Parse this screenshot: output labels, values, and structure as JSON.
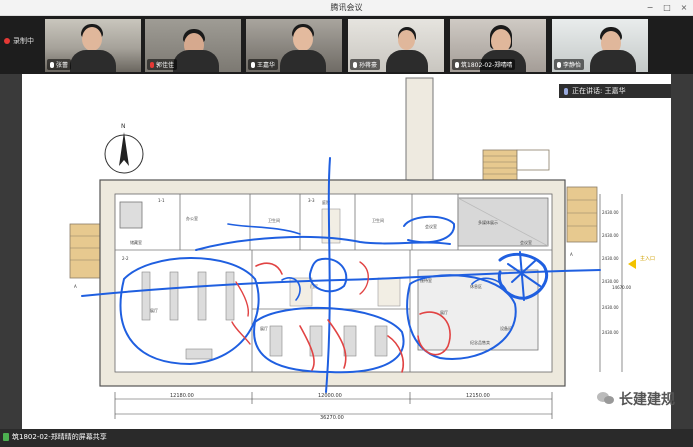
{
  "window": {
    "title": "腾讯会议",
    "controls": [
      "−",
      "□",
      "×"
    ]
  },
  "recording": {
    "label": "录制中"
  },
  "participants": [
    {
      "name": "张蕾",
      "muted": false,
      "tone": "#b9b3a8"
    },
    {
      "name": "郭佳佳",
      "muted": true,
      "tone": "#8c8980"
    },
    {
      "name": "王嘉华",
      "muted": false,
      "tone": "#9c9892"
    },
    {
      "name": "孙蒋豪",
      "muted": false,
      "tone": "#d8d5cf"
    },
    {
      "name": "筑1802-02-郑晴晴",
      "muted": false,
      "tone": "#c3c0ba"
    },
    {
      "name": "李静怡",
      "muted": false,
      "tone": "#d0d6d6"
    }
  ],
  "speaking_now": {
    "label": "正在讲话: 王嘉华"
  },
  "share_bar": {
    "label": "筑1802-02-郑晴晴的屏幕共享"
  },
  "watermark": {
    "text": "长建建规"
  },
  "plan": {
    "north_label": "N",
    "entrance_label": "主入口",
    "room_labels": [
      "卫生间",
      "卫生间",
      "办公室",
      "庭院",
      "会议室",
      "展厅",
      "展厅",
      "接待室",
      "门厅",
      "多媒体展示",
      "储藏室",
      "设备间",
      "展厅",
      "休息区",
      "会议室",
      "纪念品售卖"
    ],
    "dim_bottom": [
      "12180.00",
      "12000.00",
      "12150.00"
    ],
    "dim_total": "36270.00",
    "dim_right": [
      "2430.00",
      "2430.00",
      "2430.00",
      "2430.00",
      "2430.00",
      "2430.00",
      "14670.00"
    ],
    "side_labels": [
      "A",
      "A"
    ],
    "dim_top": [
      "1-1",
      "2-2",
      "3-3"
    ]
  }
}
